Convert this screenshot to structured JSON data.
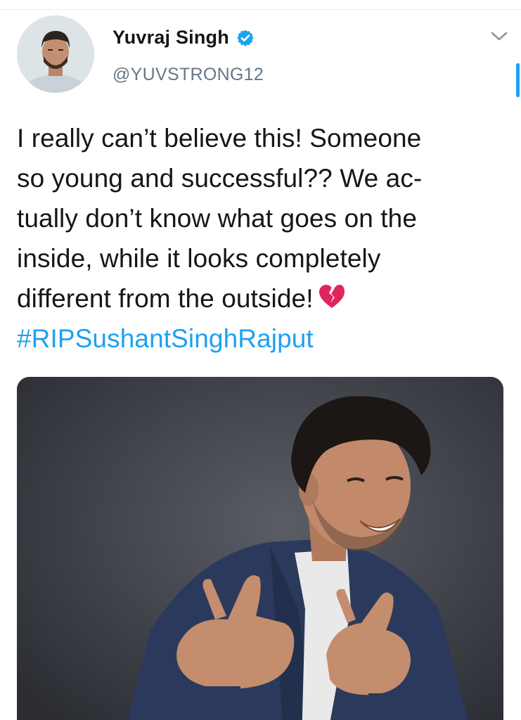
{
  "author": {
    "display_name": "Yuvraj Singh",
    "handle": "@YUVSTRONG12",
    "verified": true,
    "avatar_icon": "profile-photo"
  },
  "tweet": {
    "lines": [
      "I really can’t believe this! Someone",
      "so young and successful?? We ac-",
      "tually don’t know what goes on the",
      "inside, while it looks completely",
      "different from the outside!"
    ],
    "emoji": "broken-heart-icon",
    "hashtag": "#RIPSushantSinghRajput"
  },
  "media": {
    "icon": "photo-of-smiling-man-in-blue-blazer"
  },
  "colors": {
    "accent": "#1da1f2",
    "text": "#14171a",
    "secondary": "#657786",
    "broken_heart": "#e0245e"
  }
}
